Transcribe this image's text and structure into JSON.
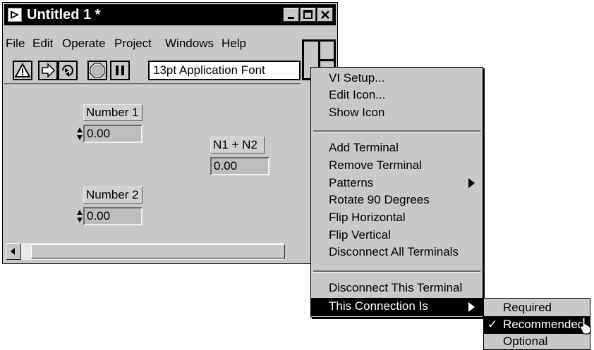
{
  "window": {
    "title": "Untitled 1 *"
  },
  "menu": [
    "File",
    "Edit",
    "Operate",
    "Project",
    "Windows",
    "Help"
  ],
  "toolbar": {
    "font_ring": "13pt Application Font",
    "icons": [
      "warning-icon",
      "run-icon",
      "run-continuously-icon",
      "abort-icon",
      "pause-icon"
    ]
  },
  "panel": {
    "number1": {
      "label": "Number 1",
      "value": "0.00"
    },
    "number2": {
      "label": "Number 2",
      "value": "0.00"
    },
    "result": {
      "label": "N1 + N2",
      "value": "0.00"
    }
  },
  "popup_menu": {
    "group1": [
      "VI Setup...",
      "Edit Icon...",
      "Show Icon"
    ],
    "group2": [
      "Add Terminal",
      "Remove Terminal",
      "Patterns",
      "Rotate 90 Degrees",
      "Flip Horizontal",
      "Flip Vertical",
      "Disconnect All Terminals"
    ],
    "group3": [
      "Disconnect This Terminal",
      "This Connection Is"
    ]
  },
  "submenu": {
    "items": [
      "Required",
      "Recommended",
      "Optional"
    ],
    "checkmark": "✓",
    "checked": "Recommended"
  },
  "colors": {
    "panel_bg": "#c8c8c8",
    "highlight": "#000000"
  }
}
